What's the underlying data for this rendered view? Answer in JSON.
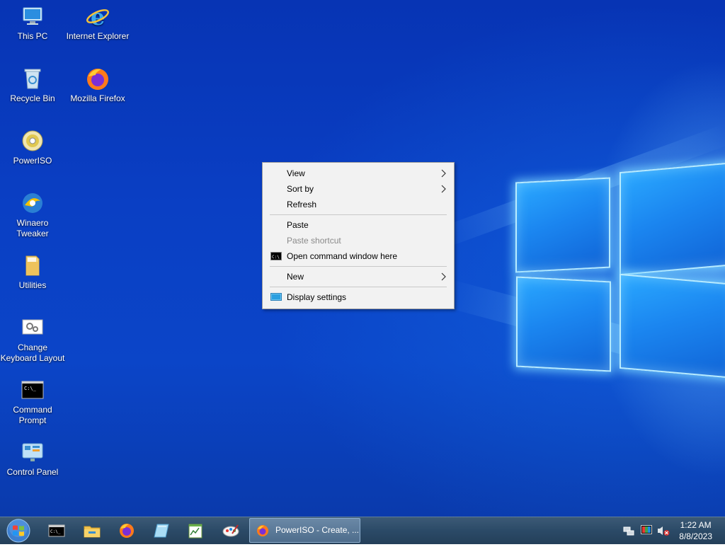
{
  "desktop": {
    "icons": [
      {
        "label": "This PC",
        "icon": "this-pc-icon"
      },
      {
        "label": "Internet Explorer",
        "icon": "internet-explorer-icon"
      },
      {
        "label": "Recycle Bin",
        "icon": "recycle-bin-icon"
      },
      {
        "label": "Mozilla Firefox",
        "icon": "firefox-icon"
      },
      {
        "label": "PowerISO",
        "icon": "poweriso-icon"
      },
      {
        "label": "Winaero Tweaker",
        "icon": "winaero-tweaker-icon"
      },
      {
        "label": "Utilities",
        "icon": "folder-icon"
      },
      {
        "label": "Change Keyboard Layout",
        "icon": "keyboard-settings-icon"
      },
      {
        "label": "Command Prompt",
        "icon": "command-prompt-icon"
      },
      {
        "label": "Control Panel",
        "icon": "control-panel-icon"
      }
    ]
  },
  "context_menu": {
    "items": [
      {
        "label": "View",
        "submenu": true
      },
      {
        "label": "Sort by",
        "submenu": true
      },
      {
        "label": "Refresh"
      },
      {
        "label": "Paste"
      },
      {
        "label": "Paste shortcut",
        "disabled": true
      },
      {
        "label": "Open command window here",
        "icon": "cmd-icon"
      },
      {
        "label": "New",
        "submenu": true
      },
      {
        "label": "Display settings",
        "icon": "display-icon"
      }
    ]
  },
  "taskbar": {
    "active_window_label": "PowerISO - Create, ...",
    "clock": {
      "time": "1:22 AM",
      "date": "8/8/2023"
    },
    "colors": {
      "background": "#2b4a67",
      "accent": "#1b86f0"
    }
  }
}
